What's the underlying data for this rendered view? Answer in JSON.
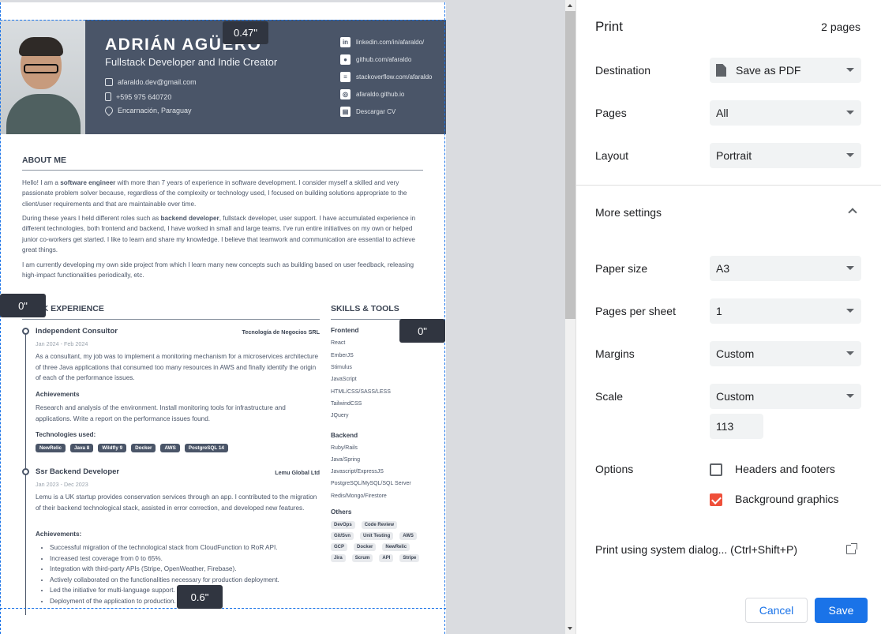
{
  "cv": {
    "name": "ADRIÁN AGÜERO",
    "role": "Fullstack Developer and Indie Creator",
    "contacts": [
      "afaraldo.dev@gmail.com",
      "+595 975 640720",
      "Encarnación, Paraguay"
    ],
    "links": [
      "linkedin.com/in/afaraldo/",
      "github.com/afaraldo",
      "stackoverflow.com/afaraldo",
      "afaraldo.github.io",
      "Descargar CV"
    ],
    "about_title": "ABOUT ME",
    "about_p1_a": "Hello! I am a ",
    "about_p1_b": "software engineer",
    "about_p1_c": " with more than 7 years of experience in software development. I consider myself a skilled and very passionate problem solver because, regardless of the complexity or technology used, I focused on building solutions appropriate to the client/user requirements and that are maintainable over time.",
    "about_p2_a": "During these years I held different roles such as ",
    "about_p2_b": "backend developer",
    "about_p2_c": ", fullstack developer, user support. I have accumulated experience in different technologies, both frontend and backend, I have worked in small and large teams. I've run entire initiatives on my own or helped junior co-workers get started. I like to learn and share my knowledge. I believe that teamwork and communication are essential to achieve great things.",
    "about_p3": "I am currently developing my own side project from which I learn many new concepts such as building based on user feedback, releasing high-impact functionalities periodically, etc.",
    "experience_title": "WORK EXPERIENCE",
    "skills_title": "SKILLS & TOOLS",
    "exp1": {
      "title": "Independent Consultor",
      "company": "Tecnología de Negocios SRL",
      "date": "Jan 2024 - Feb 2024",
      "text": "As a consultant, my job was to implement a monitoring mechanism for a microservices architecture of three Java applications that consumed too many resources in AWS and finally identify the origin of each of the performance issues.",
      "ach_title": "Achievements",
      "ach_text": "Research and analysis of the environment. Install monitoring tools for infrastructure and applications. Write a report on the performance issues found.",
      "tech_title": "Technologies used:",
      "tech": [
        "NewRelic",
        "Java 8",
        "Wildfly 9",
        "Docker",
        "AWS",
        "PostgreSQL 14"
      ]
    },
    "exp2": {
      "title": "Ssr Backend Developer",
      "company": "Lemu Global Ltd",
      "date": "Jan 2023 - Dec 2023",
      "text": "Lemu is a UK startup provides conservation services through an app. I contributed to the migration of their backend technological stack, assisted in error correction, and developed new features.",
      "ach_title": "Achievements:",
      "bullets": [
        "Successful migration of the technological stack from CloudFunction to RoR API.",
        "Increased test coverage from 0 to 65%.",
        "Integration with third-party APIs (Stripe, OpenWeather, Firebase).",
        "Actively collaborated on the functionalities necessary for production deployment.",
        "Led the initiative for multi-language support.",
        "Deployment of the application to production."
      ]
    },
    "skills": {
      "frontend_title": "Frontend",
      "frontend": [
        "React",
        "EmberJS",
        "Stimulus",
        "JavaScript",
        "HTML/CSS/SASS/LESS",
        "TailwindCSS",
        "JQuery"
      ],
      "backend_title": "Backend",
      "backend": [
        "Ruby/Rails",
        "Java/Spring",
        "Javascript/ExpressJS",
        "PostgreSQL/MySQL/SQL Server",
        "Redis/Mongo/Firestore"
      ],
      "others_title": "Others",
      "others": [
        "DevOps",
        "Code Review",
        "Git/Svn",
        "Unit Testing",
        "AWS",
        "GCP",
        "Docker",
        "NewRelic",
        "Jira",
        "Scrum",
        "API",
        "Stripe"
      ]
    }
  },
  "margins": {
    "top": "0.47\"",
    "left": "0\"",
    "right": "0\"",
    "bottom": "0.6\""
  },
  "print": {
    "title": "Print",
    "page_count": "2 pages",
    "destination_label": "Destination",
    "destination_value": "Save as PDF",
    "pages_label": "Pages",
    "pages_value": "All",
    "layout_label": "Layout",
    "layout_value": "Portrait",
    "more_settings": "More settings",
    "paper_size_label": "Paper size",
    "paper_size_value": "A3",
    "pps_label": "Pages per sheet",
    "pps_value": "1",
    "margins_label": "Margins",
    "margins_value": "Custom",
    "scale_label": "Scale",
    "scale_value": "Custom",
    "scale_input": "113",
    "options_label": "Options",
    "headers_footers": "Headers and footers",
    "headers_footers_checked": false,
    "background_graphics": "Background graphics",
    "background_graphics_checked": true,
    "system_dialog": "Print using system dialog... (Ctrl+Shift+P)",
    "cancel": "Cancel",
    "save": "Save"
  },
  "colors": {
    "accent": "#1a73e8",
    "checkbox_checked": "#ef4f3a",
    "cv_header": "#4a5568"
  }
}
